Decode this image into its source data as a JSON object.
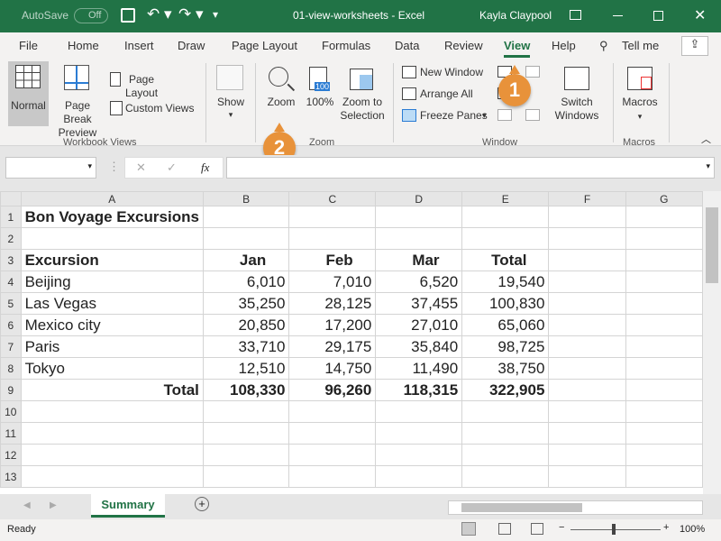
{
  "title_bar": {
    "autosave": "AutoSave",
    "autosave_state": "Off",
    "document": "01-view-worksheets - Excel",
    "user": "Kayla Claypool"
  },
  "tabs": [
    "File",
    "Home",
    "Insert",
    "Draw",
    "Page Layout",
    "Formulas",
    "Data",
    "Review",
    "View",
    "Help"
  ],
  "active_tab": "View",
  "tell_me": "Tell me",
  "ribbon": {
    "workbook_views": {
      "label": "Workbook Views",
      "normal": "Normal",
      "page_break": "Page Break Preview",
      "page_layout": "Page Layout",
      "custom_views": "Custom Views"
    },
    "show": {
      "label": "Show"
    },
    "zoom": {
      "label": "Zoom",
      "zoom": "Zoom",
      "hundred": "100%",
      "icon_text": "100",
      "zoom_selection": "Zoom to Selection"
    },
    "window": {
      "label": "Window",
      "new_window": "New Window",
      "arrange_all": "Arrange All",
      "freeze_panes": "Freeze Panes",
      "switch_windows": "Switch Windows"
    },
    "macros": {
      "label": "Macros",
      "macros": "Macros"
    }
  },
  "callouts": [
    "1",
    "2"
  ],
  "formula_bar": {
    "name_box": "",
    "fx": "fx",
    "formula": ""
  },
  "columns": [
    "A",
    "B",
    "C",
    "D",
    "E",
    "F",
    "G"
  ],
  "rows": [
    [
      "Bon Voyage Excursions",
      "",
      "",
      "",
      "",
      "",
      ""
    ],
    [
      "",
      "",
      "",
      "",
      "",
      "",
      ""
    ],
    [
      "Excursion",
      "Jan",
      "Feb",
      "Mar",
      "Total",
      "",
      ""
    ],
    [
      "Beijing",
      "6,010",
      "7,010",
      "6,520",
      "19,540",
      "",
      ""
    ],
    [
      "Las Vegas",
      "35,250",
      "28,125",
      "37,455",
      "100,830",
      "",
      ""
    ],
    [
      "Mexico city",
      "20,850",
      "17,200",
      "27,010",
      "65,060",
      "",
      ""
    ],
    [
      "Paris",
      "33,710",
      "29,175",
      "35,840",
      "98,725",
      "",
      ""
    ],
    [
      "Tokyo",
      "12,510",
      "14,750",
      "11,490",
      "38,750",
      "",
      ""
    ],
    [
      "Total",
      "108,330",
      "96,260",
      "118,315",
      "322,905",
      "",
      ""
    ],
    [
      "",
      "",
      "",
      "",
      "",
      "",
      ""
    ],
    [
      "",
      "",
      "",
      "",
      "",
      "",
      ""
    ],
    [
      "",
      "",
      "",
      "",
      "",
      "",
      ""
    ],
    [
      "",
      "",
      "",
      "",
      "",
      "",
      ""
    ]
  ],
  "sheet_tabs": [
    "Summary"
  ],
  "status": {
    "ready": "Ready",
    "zoom": "100%"
  },
  "colors": {
    "excel_green": "#217346",
    "callout": "#e8923a"
  }
}
